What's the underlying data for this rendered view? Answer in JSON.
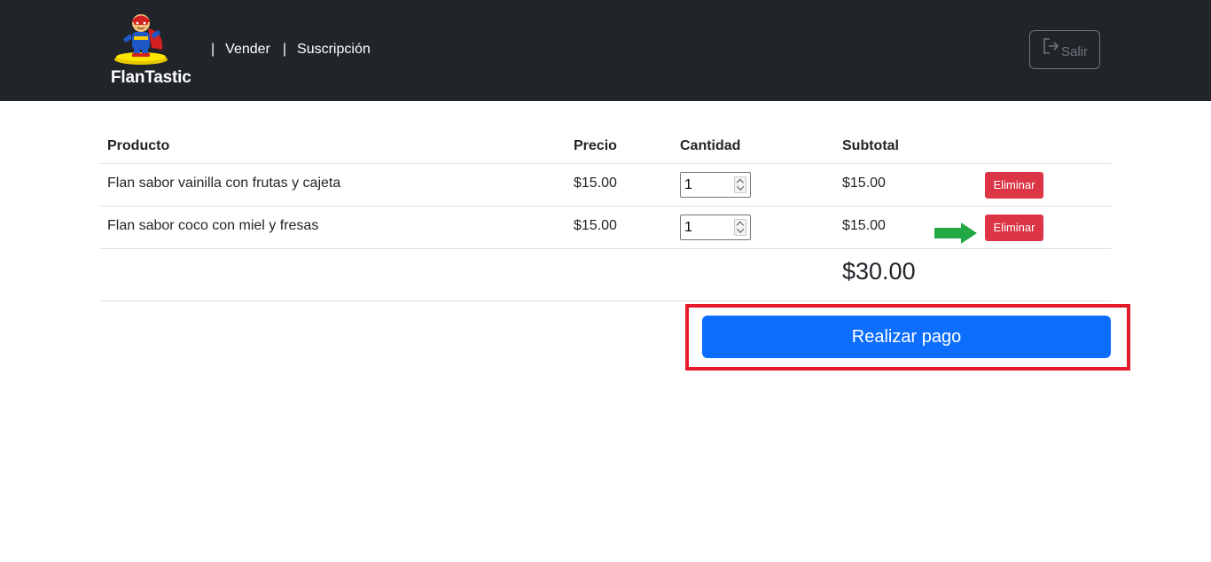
{
  "header": {
    "brand_name": "FlanTastic",
    "separator": "|",
    "nav": [
      "Vender",
      "Suscripción"
    ],
    "logout_label": "Salir",
    "logout_icon": "logout-icon"
  },
  "cart": {
    "columns": [
      "Producto",
      "Precio",
      "Cantidad",
      "Subtotal"
    ],
    "rows": [
      {
        "product": "Flan sabor vainilla con frutas y cajeta",
        "price": "$15.00",
        "quantity": "1",
        "subtotal": "$15.00",
        "action": "Eliminar"
      },
      {
        "product": "Flan sabor coco con miel y fresas",
        "price": "$15.00",
        "quantity": "1",
        "subtotal": "$15.00",
        "action": "Eliminar"
      }
    ],
    "total": "$30.00"
  },
  "pay_button": "Realizar pago",
  "colors": {
    "navbar": "#212529",
    "danger": "#dc3545",
    "primary": "#0d6efd",
    "highlight_frame": "#e31b2b",
    "arrow": "#22a845"
  }
}
